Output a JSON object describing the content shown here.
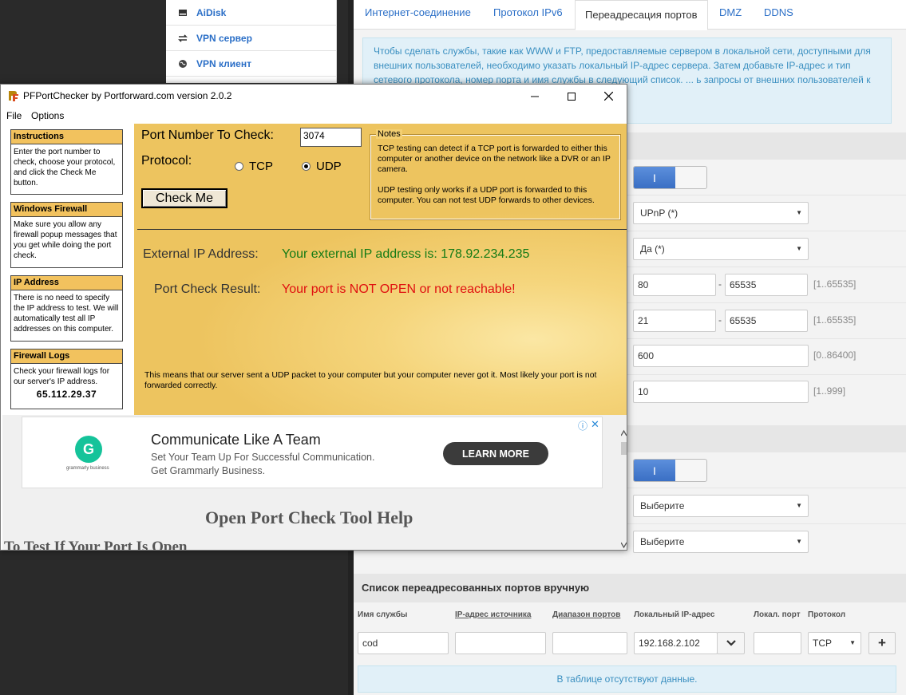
{
  "router": {
    "menu": [
      {
        "label": "AiDisk",
        "icon": "disk-icon"
      },
      {
        "label": "VPN сервер",
        "icon": "vpn-server-icon"
      },
      {
        "label": "VPN клиент",
        "icon": "globe-icon"
      }
    ],
    "tabs": [
      {
        "label": "Интернет-соединение"
      },
      {
        "label": "Протокол IPv6"
      },
      {
        "label": "Переадресация портов"
      },
      {
        "label": "DMZ"
      },
      {
        "label": "DDNS"
      }
    ],
    "info_text": "Чтобы сделать службы, такие как WWW и FTP, предоставляемые сервером в локальной сети, доступными для внешних пользователей, необходимо указать локальный IP-адрес сервера. Затем добавьте IP-адрес и тип сетевого протокола, номер порта и имя службы в следующий список. ... ь запросы от внешних пользователей к",
    "toggle_label": "I",
    "select1": "UPnP (*)",
    "select2": "Да (*)",
    "range1": {
      "from": "80",
      "to": "65535",
      "hint": "[1..65535]"
    },
    "range2": {
      "from": "21",
      "to": "65535",
      "hint": "[1..65535]"
    },
    "field3": {
      "value": "600",
      "hint": "[0..86400]"
    },
    "field4": {
      "value": "10",
      "hint": "[1..999]"
    },
    "dash": "-",
    "select3": "Выберите",
    "select4": "Выберите",
    "list_title": "Список переадресованных портов вручную",
    "columns": [
      "Имя службы",
      "IP-адрес источника",
      "Диапазон портов",
      "Локальный IP-адрес",
      "Локал. порт",
      "Протокол"
    ],
    "new_row": {
      "service": "cod",
      "local_ip": "192.168.2.102",
      "protocol": "TCP"
    },
    "empty_text": "В таблице отсутствуют данные.",
    "add_label": "+"
  },
  "pf": {
    "title": "PFPortChecker by Portforward.com version 2.0.2",
    "menu": [
      "File",
      "Options"
    ],
    "side": [
      {
        "title": "Instructions",
        "body": "Enter the port number to check, choose your protocol, and click the Check Me button."
      },
      {
        "title": "Windows Firewall",
        "body": "Make sure you allow any firewall popup messages that you get while doing the port check."
      },
      {
        "title": "IP Address",
        "body": "There is no need to specify the IP address to test. We will automatically test all IP addresses on this computer."
      },
      {
        "title": "Firewall Logs",
        "body": "Check your firewall logs for our server's IP address.",
        "ip": "65.112.29.37"
      }
    ],
    "port_label": "Port Number To Check:",
    "port_value": "3074",
    "protocol_label": "Protocol:",
    "protocols": [
      "TCP",
      "UDP"
    ],
    "selected_protocol": "UDP",
    "check_button": "Check Me",
    "notes_label": "Notes",
    "notes_p1": "TCP testing can detect if a TCP port is forwarded to either this computer or another device on the network like a DVR or an IP camera.",
    "notes_p2": "UDP testing only works if a UDP port is forwarded to this computer. You can not test UDP forwards to other devices.",
    "ext_ip_label": "External IP Address:",
    "ext_ip_value": "Your external IP address is: 178.92.234.235",
    "result_label": "Port Check Result:",
    "result_value": "Your port is NOT OPEN or not reachable!",
    "result_desc": "This means that our server sent a UDP packet to your computer but your computer never got it. Most likely your port is not forwarded correctly.",
    "ad": {
      "logo_letter": "G",
      "logo_caption": "grammarly business",
      "headline": "Communicate Like A Team",
      "sub1": "Set Your Team Up For Successful Communication.",
      "sub2": "Get Grammarly Business.",
      "button": "LEARN MORE"
    },
    "help_title": "Open Port Check Tool Help",
    "help_sub": "To Test If Your Port Is Open"
  }
}
